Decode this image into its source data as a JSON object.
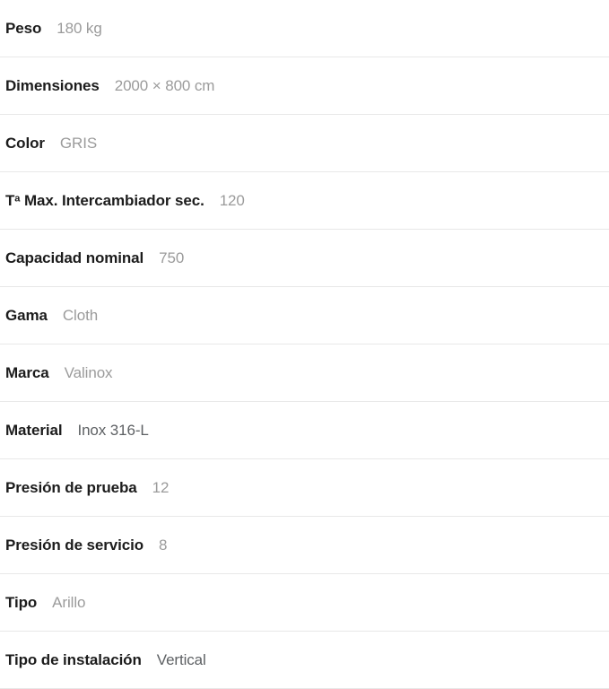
{
  "table": {
    "rows": [
      {
        "label": "Peso",
        "value": "180 kg",
        "tone": "light"
      },
      {
        "label": "Dimensiones",
        "value": "2000 × 800 cm",
        "tone": "light"
      },
      {
        "label": "Color",
        "value": "GRIS",
        "tone": "light"
      },
      {
        "label": "Tª Max. Intercambiador sec.",
        "value": "120",
        "tone": "light"
      },
      {
        "label": "Capacidad nominal",
        "value": "750",
        "tone": "light"
      },
      {
        "label": "Gama",
        "value": "Cloth",
        "tone": "light"
      },
      {
        "label": "Marca",
        "value": "Valinox",
        "tone": "light"
      },
      {
        "label": "Material",
        "value": "Inox 316-L",
        "tone": "dark"
      },
      {
        "label": "Presión de prueba",
        "value": "12",
        "tone": "light"
      },
      {
        "label": "Presión de servicio",
        "value": "8",
        "tone": "light"
      },
      {
        "label": "Tipo",
        "value": "Arillo",
        "tone": "light"
      },
      {
        "label": "Tipo de instalación",
        "value": "Vertical",
        "tone": "dark"
      }
    ]
  },
  "colors": {
    "label_text": "#1c1c1c",
    "value_text_light": "#9b9b9b",
    "value_text_dark": "#5e6164",
    "divider": "#e8e8e8",
    "background": "#ffffff"
  }
}
